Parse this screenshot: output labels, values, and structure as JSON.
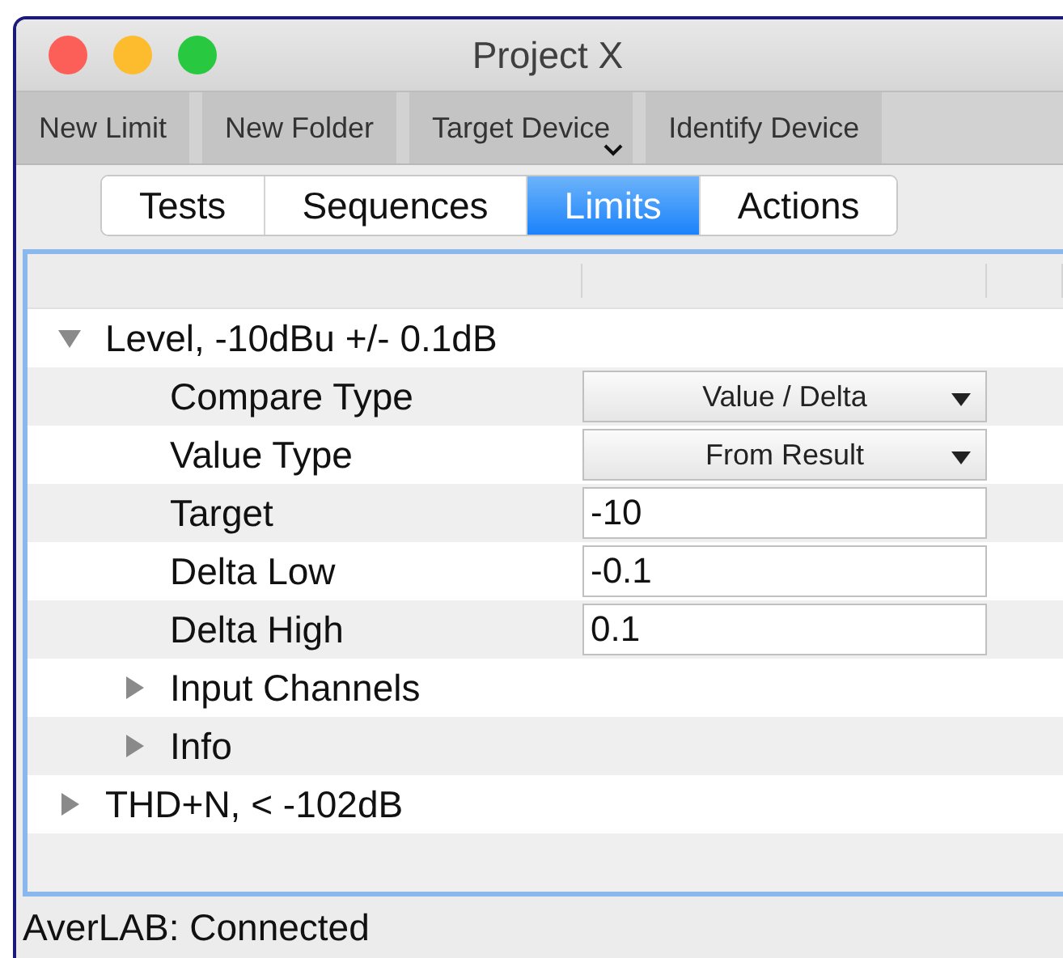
{
  "window": {
    "title": "Project X"
  },
  "toolbar": [
    {
      "label": "New Limit",
      "menu": false
    },
    {
      "label": "New Folder",
      "menu": false
    },
    {
      "label": "Target Device",
      "menu": true
    },
    {
      "label": "Identify Device",
      "menu": false
    }
  ],
  "tabs": [
    {
      "label": "Tests",
      "selected": false
    },
    {
      "label": "Sequences",
      "selected": false
    },
    {
      "label": "Limits",
      "selected": true
    },
    {
      "label": "Actions",
      "selected": false
    }
  ],
  "tree": [
    {
      "label": "Level, -10dBu +/- 0.1dB",
      "expanded": true,
      "children": [
        {
          "label": "Compare Type",
          "kind": "select",
          "value": "Value / Delta"
        },
        {
          "label": "Value Type",
          "kind": "select",
          "value": "From Result"
        },
        {
          "label": "Target",
          "kind": "text",
          "value": "-10"
        },
        {
          "label": "Delta Low",
          "kind": "text",
          "value": "-0.1"
        },
        {
          "label": "Delta High",
          "kind": "text",
          "value": "0.1"
        },
        {
          "label": "Input Channels",
          "kind": "group",
          "expanded": false
        },
        {
          "label": "Info",
          "kind": "group",
          "expanded": false
        }
      ]
    },
    {
      "label": "THD+N, < -102dB",
      "expanded": false
    }
  ],
  "status_bar": "AverLAB: Connected"
}
